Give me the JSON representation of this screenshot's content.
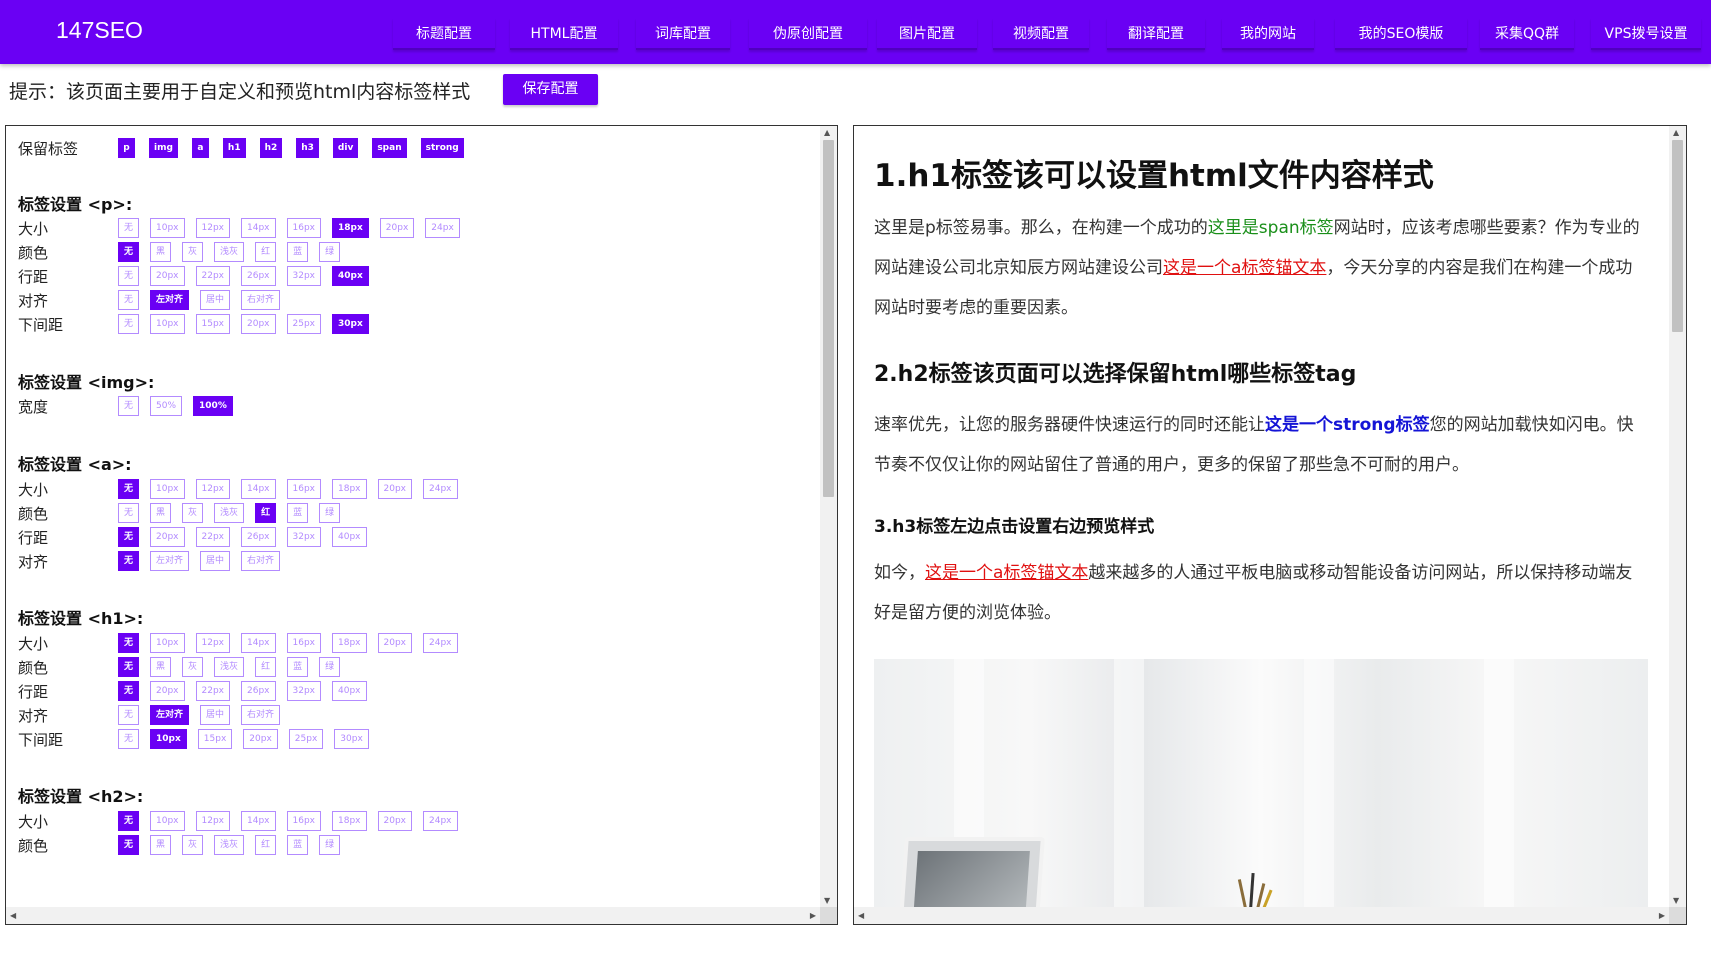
{
  "brand": "147SEO",
  "nav": [
    {
      "label": "标题配置"
    },
    {
      "label": "HTML配置"
    },
    {
      "label": "词库配置"
    },
    {
      "label": "伪原创配置"
    },
    {
      "label": "图片配置"
    },
    {
      "label": "视频配置"
    },
    {
      "label": "翻译配置"
    },
    {
      "label": "我的网站"
    },
    {
      "label": "我的SEO模版"
    },
    {
      "label": "采集QQ群"
    },
    {
      "label": "VPS拨号设置"
    }
  ],
  "hint": "提示：该页面主要用于自定义和预览html内容标签样式",
  "save_label": "保存配置",
  "left": {
    "keep_label": "保留标签",
    "keep_tags": [
      "p",
      "img",
      "a",
      "h1",
      "h2",
      "h3",
      "div",
      "span",
      "strong"
    ],
    "sections": {
      "p": {
        "title": "标签设置 <p>:",
        "rows": [
          {
            "label": "大小",
            "opts": [
              "无",
              "10px",
              "12px",
              "14px",
              "16px",
              "18px",
              "20px",
              "24px"
            ],
            "selected": "18px"
          },
          {
            "label": "颜色",
            "opts": [
              "无",
              "黑",
              "灰",
              "浅灰",
              "红",
              "蓝",
              "绿"
            ],
            "selected": "无"
          },
          {
            "label": "行距",
            "opts": [
              "无",
              "20px",
              "22px",
              "26px",
              "32px",
              "40px"
            ],
            "selected": "40px"
          },
          {
            "label": "对齐",
            "opts": [
              "无",
              "左对齐",
              "居中",
              "右对齐"
            ],
            "selected": "左对齐"
          },
          {
            "label": "下间距",
            "opts": [
              "无",
              "10px",
              "15px",
              "20px",
              "25px",
              "30px"
            ],
            "selected": "30px"
          }
        ]
      },
      "img": {
        "title": "标签设置 <img>:",
        "rows": [
          {
            "label": "宽度",
            "opts": [
              "无",
              "50%",
              "100%"
            ],
            "selected": "100%"
          }
        ]
      },
      "a": {
        "title": "标签设置 <a>:",
        "rows": [
          {
            "label": "大小",
            "opts": [
              "无",
              "10px",
              "12px",
              "14px",
              "16px",
              "18px",
              "20px",
              "24px"
            ],
            "selected": "无"
          },
          {
            "label": "颜色",
            "opts": [
              "无",
              "黑",
              "灰",
              "浅灰",
              "红",
              "蓝",
              "绿"
            ],
            "selected": "红"
          },
          {
            "label": "行距",
            "opts": [
              "无",
              "20px",
              "22px",
              "26px",
              "32px",
              "40px"
            ],
            "selected": "无"
          },
          {
            "label": "对齐",
            "opts": [
              "无",
              "左对齐",
              "居中",
              "右对齐"
            ],
            "selected": "无"
          }
        ]
      },
      "h1": {
        "title": "标签设置 <h1>:",
        "rows": [
          {
            "label": "大小",
            "opts": [
              "无",
              "10px",
              "12px",
              "14px",
              "16px",
              "18px",
              "20px",
              "24px"
            ],
            "selected": "无"
          },
          {
            "label": "颜色",
            "opts": [
              "无",
              "黑",
              "灰",
              "浅灰",
              "红",
              "蓝",
              "绿"
            ],
            "selected": "无"
          },
          {
            "label": "行距",
            "opts": [
              "无",
              "20px",
              "22px",
              "26px",
              "32px",
              "40px"
            ],
            "selected": "无"
          },
          {
            "label": "对齐",
            "opts": [
              "无",
              "左对齐",
              "居中",
              "右对齐"
            ],
            "selected": "左对齐"
          },
          {
            "label": "下间距",
            "opts": [
              "无",
              "10px",
              "15px",
              "20px",
              "25px",
              "30px"
            ],
            "selected": "10px"
          }
        ]
      },
      "h2": {
        "title": "标签设置 <h2>:",
        "rows": [
          {
            "label": "大小",
            "opts": [
              "无",
              "10px",
              "12px",
              "14px",
              "16px",
              "18px",
              "20px",
              "24px"
            ],
            "selected": "无"
          },
          {
            "label": "颜色",
            "opts": [
              "无",
              "黑",
              "灰",
              "浅灰",
              "红",
              "蓝",
              "绿"
            ],
            "selected": "无"
          }
        ]
      }
    }
  },
  "preview": {
    "h1": "1.h1标签该可以设置html文件内容样式",
    "p1_a": "这里是p标签易事。那么，在构建一个成功的",
    "p1_span": "这里是span标签",
    "p1_b": "网站时，应该考虑哪些要素？作为专业的网站建设公司北京知辰方网站建设公司",
    "p1_link": "这是一个a标签锚文本",
    "p1_c": "，今天分享的内容是我们在构建一个成功网站时要考虑的重要因素。",
    "h2": "2.h2标签该页面可以选择保留html哪些标签tag",
    "p2_a": "速率优先，让您的服务器硬件快速运行的同时还能让",
    "p2_strong": "这是一个strong标签",
    "p2_b": "您的网站加载快如闪电。快节奏不仅仅让你的网站留住了普通的用户，更多的保留了那些急不可耐的用户。",
    "h3": "3.h3标签左边点击设置右边预览样式",
    "p3_a": "如今，",
    "p3_link": "这是一个a标签锚文本",
    "p3_b": "越来越多的人通过平板电脑或移动智能设备访问网站，所以保持移动端友好是留方便的浏览体验。"
  },
  "colors": {
    "accent": "#6a00f4",
    "link": "#e01010",
    "span": "#1a8f1a",
    "strong": "#1414d6"
  }
}
